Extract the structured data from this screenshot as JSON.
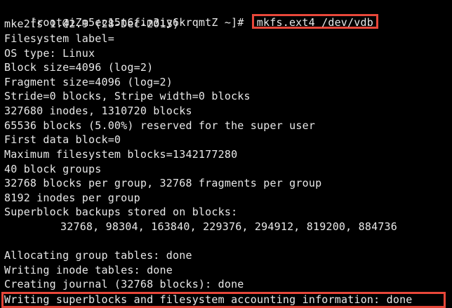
{
  "terminal": {
    "prompt": "[root@iZm5ec15t6fim3iy6krqmtZ ~]# ",
    "command": "mkfs.ext4 /dev/vdb",
    "output": [
      "mke2fs 1.42.9 (28-Dec-2013)",
      "Filesystem label=",
      "OS type: Linux",
      "Block size=4096 (log=2)",
      "Fragment size=4096 (log=2)",
      "Stride=0 blocks, Stripe width=0 blocks",
      "327680 inodes, 1310720 blocks",
      "65536 blocks (5.00%) reserved for the super user",
      "First data block=0",
      "Maximum filesystem blocks=1342177280",
      "40 block groups",
      "32768 blocks per group, 32768 fragments per group",
      "8192 inodes per group",
      "Superblock backups stored on blocks:",
      "32768, 98304, 163840, 229376, 294912, 819200, 884736",
      "",
      "Allocating group tables: done",
      "Writing inode tables: done",
      "Creating journal (32768 blocks): done"
    ],
    "final_line": "Writing superblocks and filesystem accounting information: done",
    "colors": {
      "background": "#000000",
      "text": "#e8e8e8",
      "highlight_border": "#e8473a"
    }
  }
}
